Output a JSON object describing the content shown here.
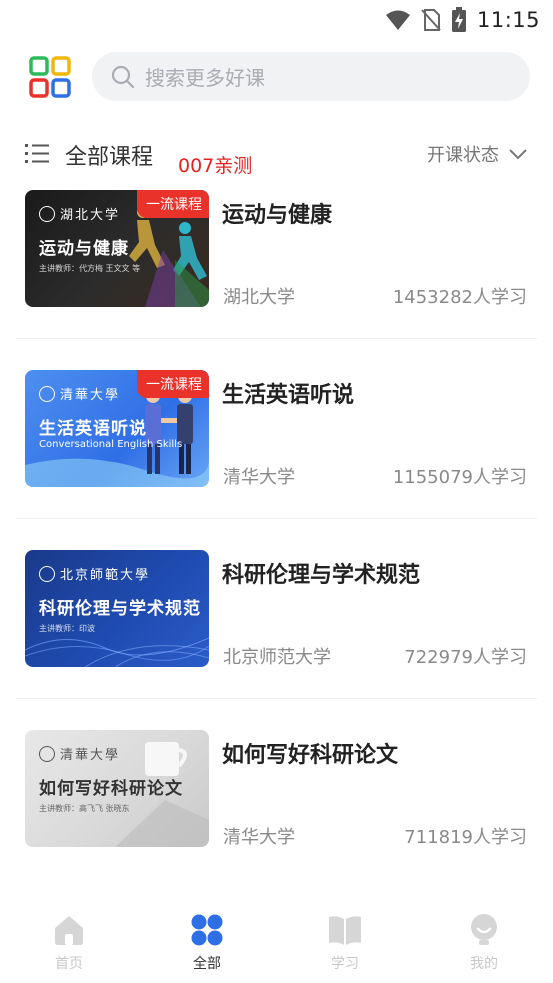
{
  "status_bar": {
    "time": "11:15"
  },
  "search": {
    "placeholder": "搜索更多好课"
  },
  "filter": {
    "title": "全部课程",
    "note": "007亲测",
    "status_label": "开课状态"
  },
  "courses": [
    {
      "title": "运动与健康",
      "school": "湖北大学",
      "learners": "1453282人学习",
      "badge": "一流课程",
      "thumb_title": "运动与健康",
      "thumb_school": "湖北大学",
      "thumb_teacher": "主讲教师：代方梅 王文文 等"
    },
    {
      "title": "生活英语听说",
      "school": "清华大学",
      "learners": "1155079人学习",
      "badge": "一流课程",
      "thumb_title": "生活英语听说",
      "thumb_subtitle": "Conversational English Skills",
      "thumb_school": "清華大學"
    },
    {
      "title": "科研伦理与学术规范",
      "school": "北京师范大学",
      "learners": "722979人学习",
      "thumb_title": "科研伦理与学术规范",
      "thumb_school": "北京師範大學",
      "thumb_teacher": "主讲教师：印波"
    },
    {
      "title": "如何写好科研论文",
      "school": "清华大学",
      "learners": "711819人学习",
      "thumb_title": "如何写好科研论文",
      "thumb_school": "清華大學",
      "thumb_teacher": "主讲教师：高飞飞 张晓东"
    }
  ],
  "tabs": [
    {
      "label": "首页",
      "icon": "home-icon",
      "active": false
    },
    {
      "label": "全部",
      "icon": "grid-icon",
      "active": true
    },
    {
      "label": "学习",
      "icon": "book-icon",
      "active": false
    },
    {
      "label": "我的",
      "icon": "profile-icon",
      "active": false
    }
  ],
  "colors": {
    "accent": "#2f6fe6",
    "badge": "#e8322a",
    "note": "#e52222",
    "muted": "#8a8a8a",
    "inactive_tab": "#c8c8c8"
  }
}
